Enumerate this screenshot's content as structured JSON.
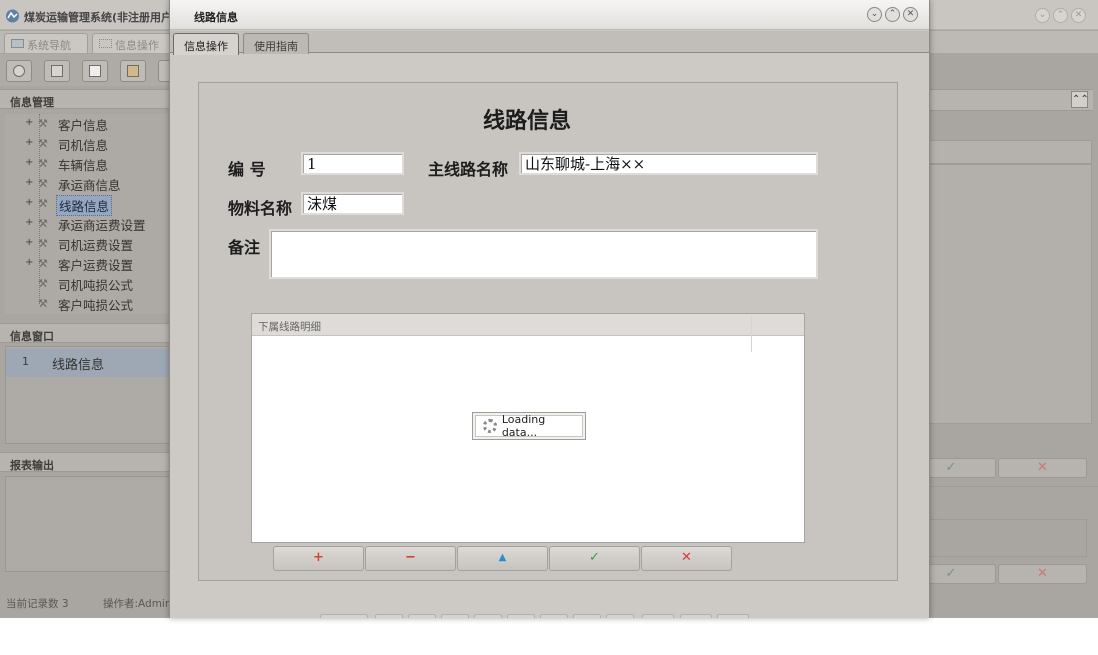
{
  "app": {
    "title": "煤炭运输管理系统(非注册用户",
    "tabs": [
      "系统导航",
      "信息操作"
    ]
  },
  "sidebar": {
    "info_mgmt_header": "信息管理",
    "tree": [
      {
        "label": "客户信息",
        "expandable": true,
        "selected": false
      },
      {
        "label": "司机信息",
        "expandable": true,
        "selected": false
      },
      {
        "label": "车辆信息",
        "expandable": true,
        "selected": false
      },
      {
        "label": "承运商信息",
        "expandable": true,
        "selected": false
      },
      {
        "label": "线路信息",
        "expandable": true,
        "selected": true
      },
      {
        "label": "承运商运费设置",
        "expandable": true,
        "selected": false
      },
      {
        "label": "司机运费设置",
        "expandable": true,
        "selected": false
      },
      {
        "label": "客户运费设置",
        "expandable": true,
        "selected": false
      },
      {
        "label": "司机吨损公式",
        "expandable": false,
        "selected": false
      },
      {
        "label": "客户吨损公式",
        "expandable": false,
        "selected": false
      }
    ],
    "info_window_header": "信息窗口",
    "info_window_rows": [
      {
        "num": "1",
        "label": "线路信息"
      }
    ],
    "report_header": "报表输出"
  },
  "status_bar": {
    "record_count": "当前记录数 3",
    "operator": "操作者:Admin"
  },
  "dialog": {
    "title": "线路信息",
    "tabs": [
      "信息操作",
      "使用指南"
    ],
    "form": {
      "heading": "线路信息",
      "code_label": "编  号",
      "code_value": "1",
      "route_name_label": "主线路名称",
      "route_name_value": "山东聊城-上海××",
      "material_label": "物料名称",
      "material_value": "沫煤",
      "remark_label": "备注",
      "remark_value": ""
    },
    "grid": {
      "columns": [
        "下属线路明细"
      ],
      "loading_text": "Loading data..."
    },
    "grid_actions": {
      "add": "+",
      "remove": "−",
      "up": "▲",
      "confirm": "✓",
      "cancel": "✕"
    }
  },
  "glyphs": {
    "plus": "+",
    "leaf_icon": "⚒",
    "minimize": "⌄",
    "maximize": "⌃",
    "close": "✕",
    "collapse": "⌃⌃",
    "check": "✓",
    "cross": "✕"
  },
  "colors": {
    "selected_item": "#94a7bf",
    "add_red": "#d24a2d",
    "confirm_green": "#3c9a44",
    "up_blue": "#2a8fc6"
  }
}
